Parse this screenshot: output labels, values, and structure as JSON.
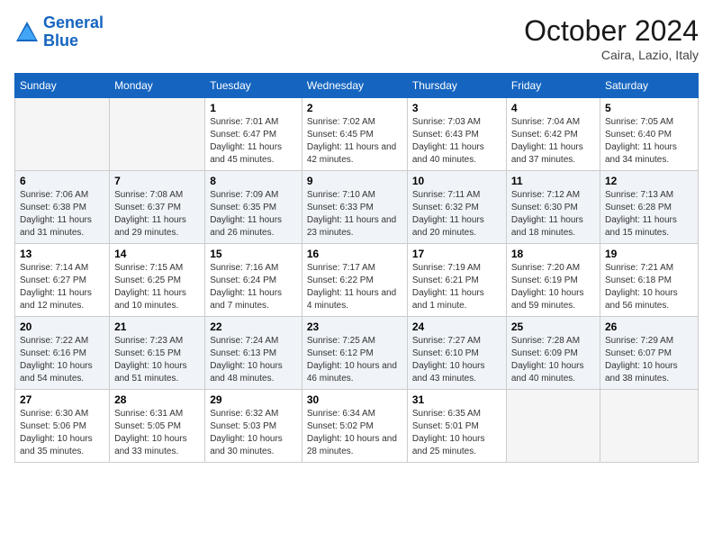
{
  "logo": {
    "line1": "General",
    "line2": "Blue"
  },
  "title": "October 2024",
  "location": "Caira, Lazio, Italy",
  "days_header": [
    "Sunday",
    "Monday",
    "Tuesday",
    "Wednesday",
    "Thursday",
    "Friday",
    "Saturday"
  ],
  "weeks": [
    [
      {
        "day": "",
        "info": ""
      },
      {
        "day": "",
        "info": ""
      },
      {
        "day": "1",
        "info": "Sunrise: 7:01 AM\nSunset: 6:47 PM\nDaylight: 11 hours and 45 minutes."
      },
      {
        "day": "2",
        "info": "Sunrise: 7:02 AM\nSunset: 6:45 PM\nDaylight: 11 hours and 42 minutes."
      },
      {
        "day": "3",
        "info": "Sunrise: 7:03 AM\nSunset: 6:43 PM\nDaylight: 11 hours and 40 minutes."
      },
      {
        "day": "4",
        "info": "Sunrise: 7:04 AM\nSunset: 6:42 PM\nDaylight: 11 hours and 37 minutes."
      },
      {
        "day": "5",
        "info": "Sunrise: 7:05 AM\nSunset: 6:40 PM\nDaylight: 11 hours and 34 minutes."
      }
    ],
    [
      {
        "day": "6",
        "info": "Sunrise: 7:06 AM\nSunset: 6:38 PM\nDaylight: 11 hours and 31 minutes."
      },
      {
        "day": "7",
        "info": "Sunrise: 7:08 AM\nSunset: 6:37 PM\nDaylight: 11 hours and 29 minutes."
      },
      {
        "day": "8",
        "info": "Sunrise: 7:09 AM\nSunset: 6:35 PM\nDaylight: 11 hours and 26 minutes."
      },
      {
        "day": "9",
        "info": "Sunrise: 7:10 AM\nSunset: 6:33 PM\nDaylight: 11 hours and 23 minutes."
      },
      {
        "day": "10",
        "info": "Sunrise: 7:11 AM\nSunset: 6:32 PM\nDaylight: 11 hours and 20 minutes."
      },
      {
        "day": "11",
        "info": "Sunrise: 7:12 AM\nSunset: 6:30 PM\nDaylight: 11 hours and 18 minutes."
      },
      {
        "day": "12",
        "info": "Sunrise: 7:13 AM\nSunset: 6:28 PM\nDaylight: 11 hours and 15 minutes."
      }
    ],
    [
      {
        "day": "13",
        "info": "Sunrise: 7:14 AM\nSunset: 6:27 PM\nDaylight: 11 hours and 12 minutes."
      },
      {
        "day": "14",
        "info": "Sunrise: 7:15 AM\nSunset: 6:25 PM\nDaylight: 11 hours and 10 minutes."
      },
      {
        "day": "15",
        "info": "Sunrise: 7:16 AM\nSunset: 6:24 PM\nDaylight: 11 hours and 7 minutes."
      },
      {
        "day": "16",
        "info": "Sunrise: 7:17 AM\nSunset: 6:22 PM\nDaylight: 11 hours and 4 minutes."
      },
      {
        "day": "17",
        "info": "Sunrise: 7:19 AM\nSunset: 6:21 PM\nDaylight: 11 hours and 1 minute."
      },
      {
        "day": "18",
        "info": "Sunrise: 7:20 AM\nSunset: 6:19 PM\nDaylight: 10 hours and 59 minutes."
      },
      {
        "day": "19",
        "info": "Sunrise: 7:21 AM\nSunset: 6:18 PM\nDaylight: 10 hours and 56 minutes."
      }
    ],
    [
      {
        "day": "20",
        "info": "Sunrise: 7:22 AM\nSunset: 6:16 PM\nDaylight: 10 hours and 54 minutes."
      },
      {
        "day": "21",
        "info": "Sunrise: 7:23 AM\nSunset: 6:15 PM\nDaylight: 10 hours and 51 minutes."
      },
      {
        "day": "22",
        "info": "Sunrise: 7:24 AM\nSunset: 6:13 PM\nDaylight: 10 hours and 48 minutes."
      },
      {
        "day": "23",
        "info": "Sunrise: 7:25 AM\nSunset: 6:12 PM\nDaylight: 10 hours and 46 minutes."
      },
      {
        "day": "24",
        "info": "Sunrise: 7:27 AM\nSunset: 6:10 PM\nDaylight: 10 hours and 43 minutes."
      },
      {
        "day": "25",
        "info": "Sunrise: 7:28 AM\nSunset: 6:09 PM\nDaylight: 10 hours and 40 minutes."
      },
      {
        "day": "26",
        "info": "Sunrise: 7:29 AM\nSunset: 6:07 PM\nDaylight: 10 hours and 38 minutes."
      }
    ],
    [
      {
        "day": "27",
        "info": "Sunrise: 6:30 AM\nSunset: 5:06 PM\nDaylight: 10 hours and 35 minutes."
      },
      {
        "day": "28",
        "info": "Sunrise: 6:31 AM\nSunset: 5:05 PM\nDaylight: 10 hours and 33 minutes."
      },
      {
        "day": "29",
        "info": "Sunrise: 6:32 AM\nSunset: 5:03 PM\nDaylight: 10 hours and 30 minutes."
      },
      {
        "day": "30",
        "info": "Sunrise: 6:34 AM\nSunset: 5:02 PM\nDaylight: 10 hours and 28 minutes."
      },
      {
        "day": "31",
        "info": "Sunrise: 6:35 AM\nSunset: 5:01 PM\nDaylight: 10 hours and 25 minutes."
      },
      {
        "day": "",
        "info": ""
      },
      {
        "day": "",
        "info": ""
      }
    ]
  ]
}
